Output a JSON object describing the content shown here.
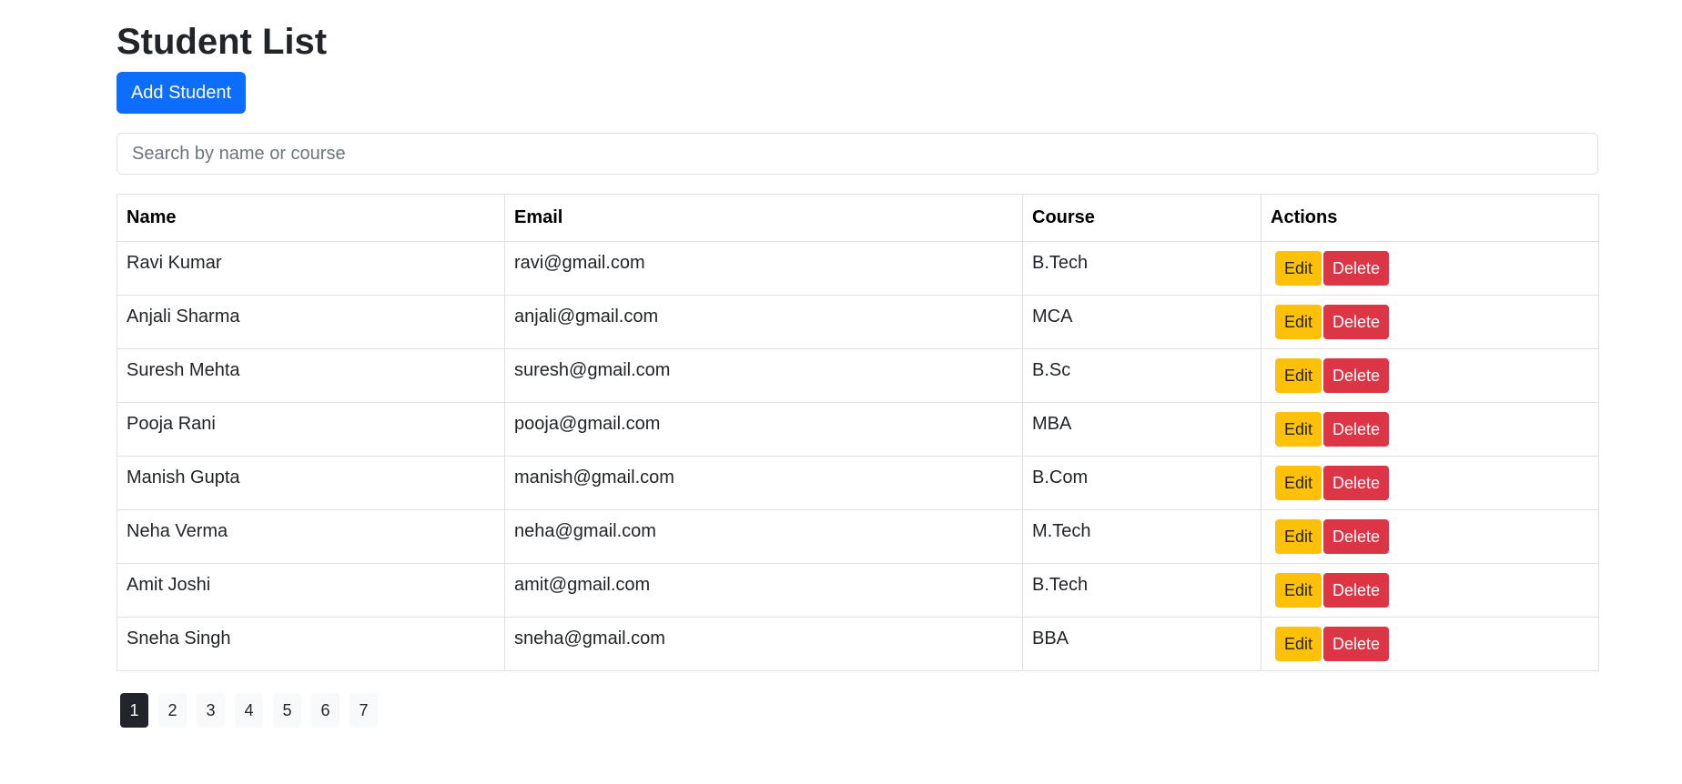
{
  "page": {
    "title": "Student List",
    "add_button_label": "Add Student"
  },
  "search": {
    "placeholder": "Search by name or course",
    "value": ""
  },
  "table": {
    "columns": [
      "Name",
      "Email",
      "Course",
      "Actions"
    ],
    "rows": [
      {
        "name": "Ravi Kumar",
        "email": "ravi@gmail.com",
        "course": "B.Tech"
      },
      {
        "name": "Anjali Sharma",
        "email": "anjali@gmail.com",
        "course": "MCA"
      },
      {
        "name": "Suresh Mehta",
        "email": "suresh@gmail.com",
        "course": "B.Sc"
      },
      {
        "name": "Pooja Rani",
        "email": "pooja@gmail.com",
        "course": "MBA"
      },
      {
        "name": "Manish Gupta",
        "email": "manish@gmail.com",
        "course": "B.Com"
      },
      {
        "name": "Neha Verma",
        "email": "neha@gmail.com",
        "course": "M.Tech"
      },
      {
        "name": "Amit Joshi",
        "email": "amit@gmail.com",
        "course": "B.Tech"
      },
      {
        "name": "Sneha Singh",
        "email": "sneha@gmail.com",
        "course": "BBA"
      }
    ],
    "edit_label": "Edit",
    "delete_label": "Delete"
  },
  "pagination": {
    "pages": [
      "1",
      "2",
      "3",
      "4",
      "5",
      "6",
      "7"
    ],
    "current": "1"
  },
  "colors": {
    "primary": "#0d6efd",
    "warning": "#ffc107",
    "danger": "#dc3545",
    "active_page": "#212529"
  }
}
